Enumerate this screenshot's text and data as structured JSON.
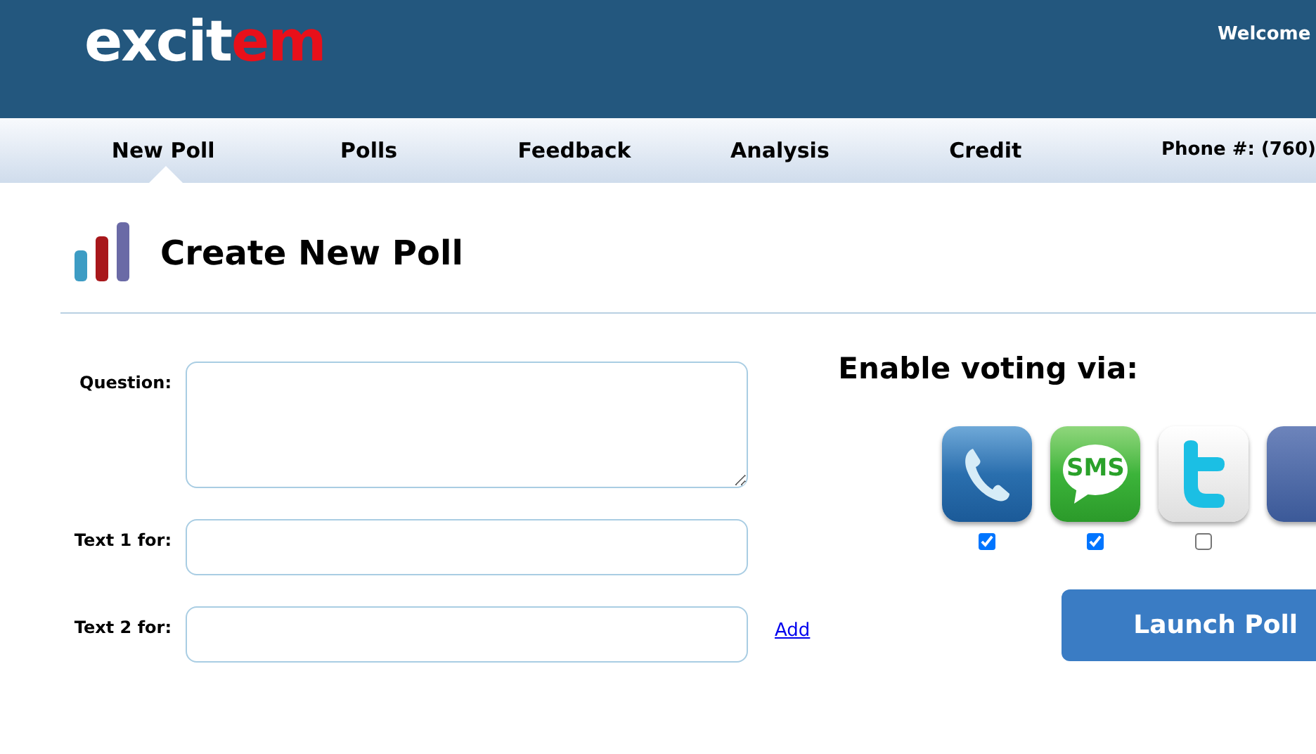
{
  "header": {
    "logo": [
      {
        "text": "excit",
        "accent": false
      },
      {
        "text": "em",
        "accent": true
      }
    ],
    "welcome": "Welcome"
  },
  "nav": {
    "tabs": [
      {
        "label": "New Poll",
        "selected": true
      },
      {
        "label": "Polls",
        "selected": false
      },
      {
        "label": "Feedback",
        "selected": false
      },
      {
        "label": "Analysis",
        "selected": false
      },
      {
        "label": "Credit",
        "selected": false
      }
    ],
    "phone": "Phone #: (760)"
  },
  "page": {
    "title": "Create New Poll"
  },
  "form": {
    "fields": [
      {
        "label": "Question:",
        "kind": "textarea"
      },
      {
        "label": "Text 1 for:",
        "kind": "input"
      },
      {
        "label": "Text 2 for:",
        "kind": "input",
        "link": "Add"
      }
    ]
  },
  "voting": {
    "heading": "Enable voting via:",
    "channels": [
      {
        "kind": "phone",
        "checked": true
      },
      {
        "kind": "sms",
        "label": "SMS",
        "checked": true
      },
      {
        "kind": "twitter",
        "checked": false
      },
      {
        "kind": "blue"
      }
    ],
    "launch": "Launch Poll"
  }
}
